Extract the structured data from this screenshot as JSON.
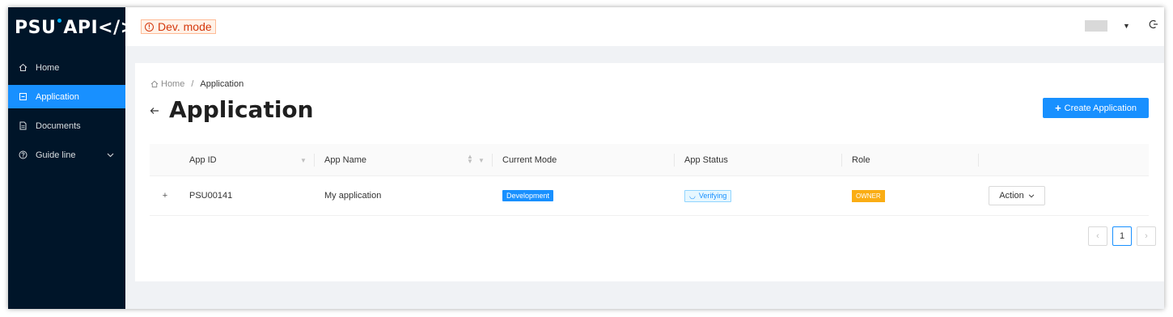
{
  "brand": {
    "logo_left": "PSU",
    "logo_right": "API</>"
  },
  "sidebar": {
    "items": [
      {
        "label": "Home",
        "icon": "home-icon",
        "active": false
      },
      {
        "label": "Application",
        "icon": "application-icon",
        "active": true
      },
      {
        "label": "Documents",
        "icon": "document-icon",
        "active": false
      },
      {
        "label": "Guide line",
        "icon": "question-circle-icon",
        "active": false,
        "expandable": true
      }
    ]
  },
  "topbar": {
    "mode_badge": "Dev. mode",
    "warn_glyph": "!"
  },
  "breadcrumb": {
    "home": "Home",
    "separator": "/",
    "current": "Application"
  },
  "page": {
    "title": "Application",
    "create_button": "Create Application"
  },
  "table": {
    "columns": [
      "App ID",
      "App Name",
      "Current Mode",
      "App Status",
      "Role"
    ],
    "rows": [
      {
        "expand": "+",
        "app_id": "PSU00141",
        "app_name": "My application",
        "mode": "Development",
        "status": "Verifying",
        "role": "OWNER",
        "action": "Action"
      }
    ]
  },
  "pagination": {
    "prev": "‹",
    "current": "1",
    "next": "›"
  },
  "colors": {
    "sidebar_bg": "#001529",
    "accent": "#1890ff",
    "dev_badge": "#d4380d",
    "owner_tag": "#faad14"
  }
}
